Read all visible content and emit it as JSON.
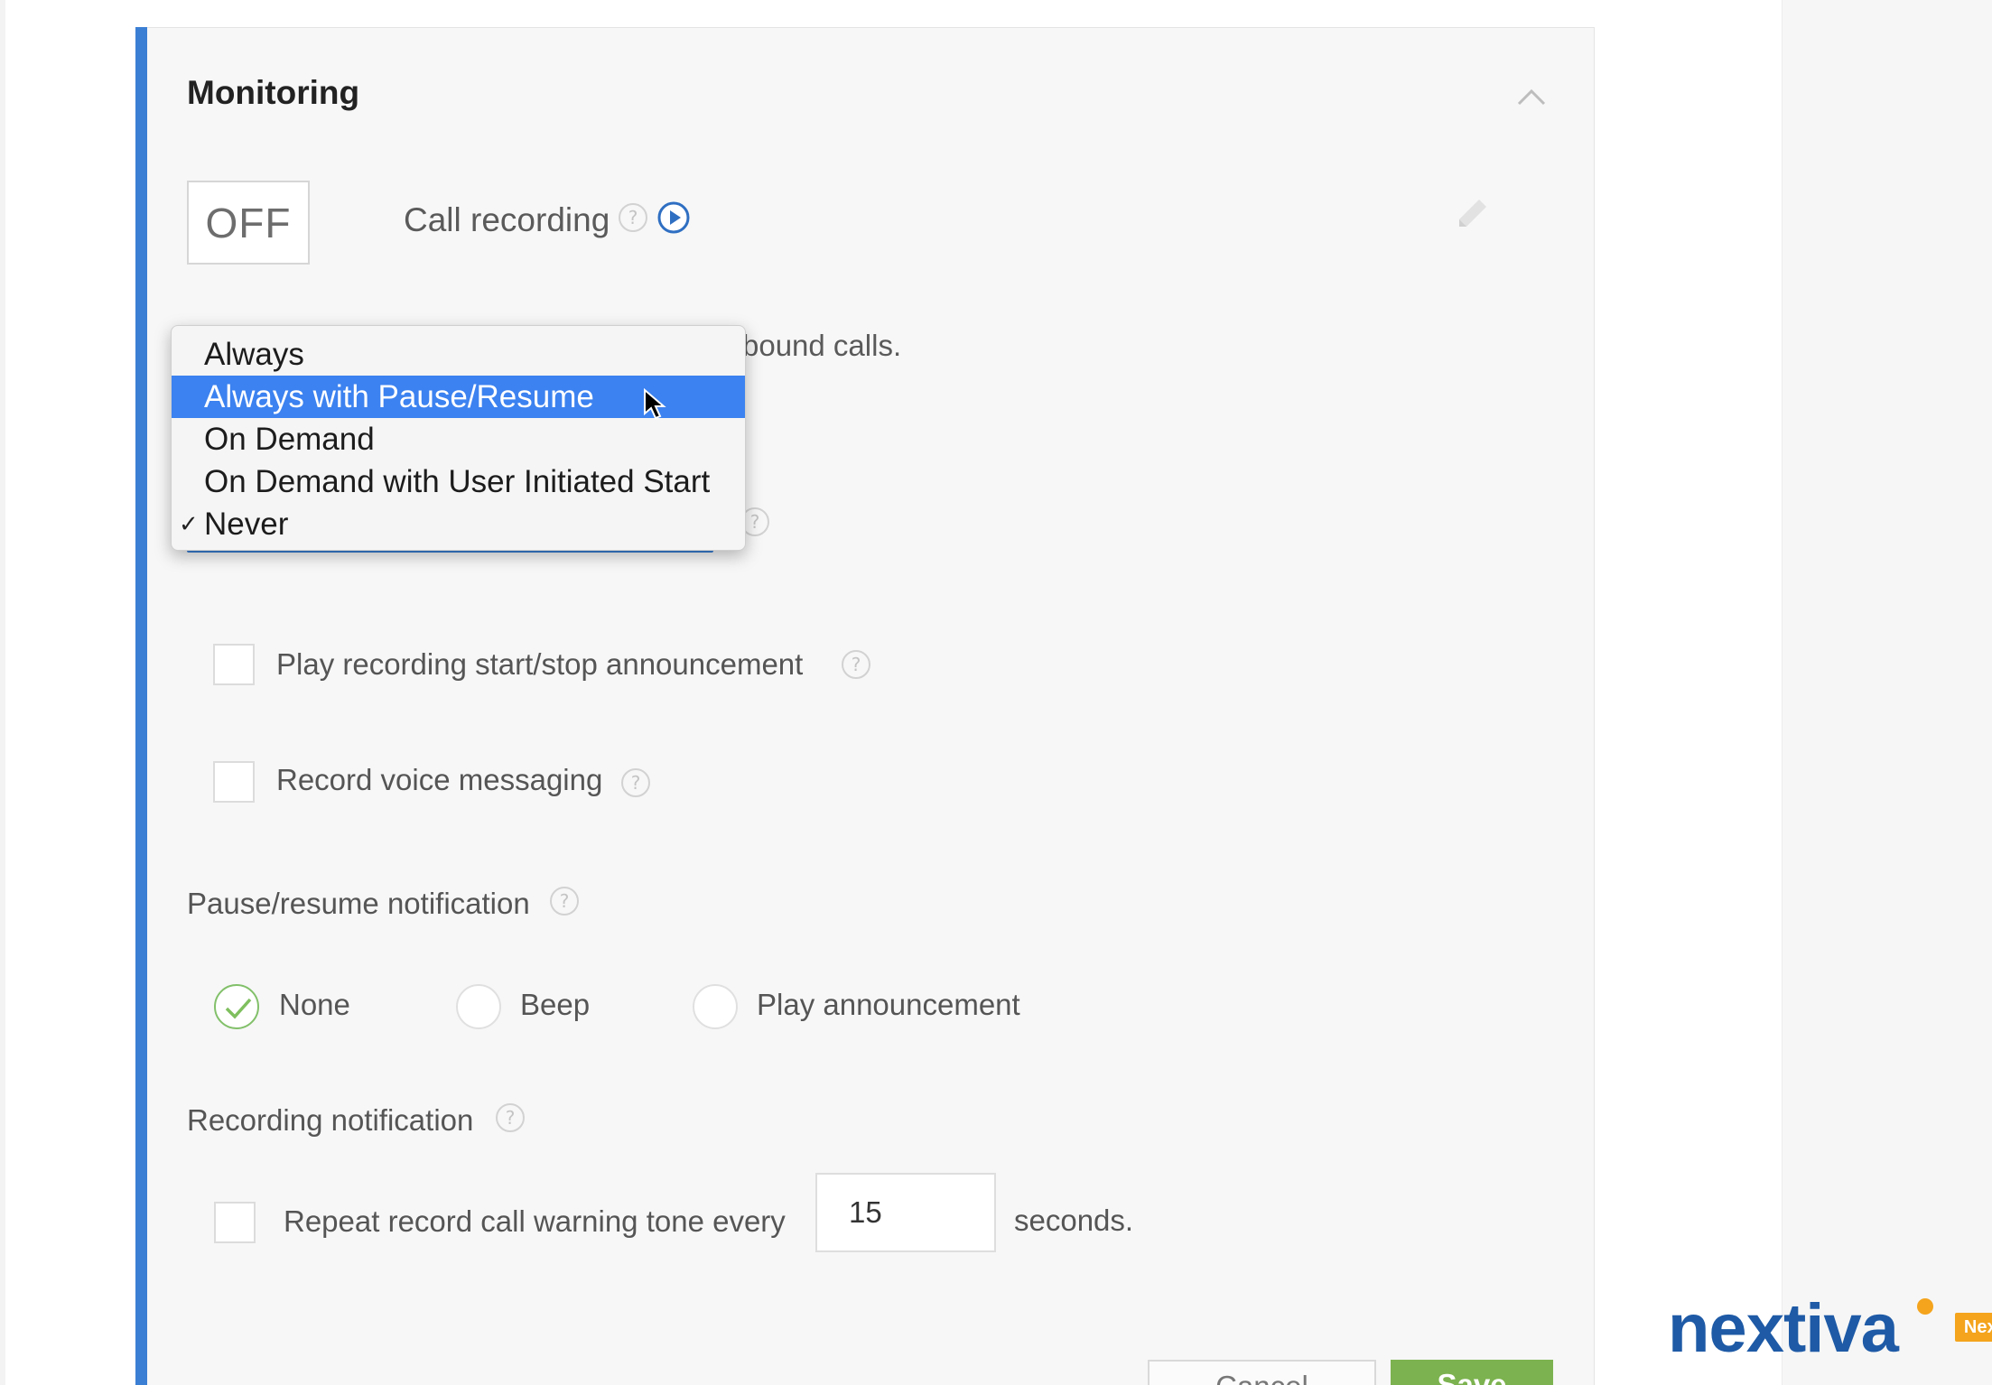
{
  "section": {
    "title": "Monitoring"
  },
  "call_recording": {
    "toggle_state": "OFF",
    "label": "Call recording",
    "help_glyph": "?",
    "bg_text": "bound calls.",
    "options": [
      {
        "label": "Always",
        "checked": false,
        "highlighted": false
      },
      {
        "label": "Always with Pause/Resume",
        "checked": false,
        "highlighted": true
      },
      {
        "label": "On Demand",
        "checked": false,
        "highlighted": false
      },
      {
        "label": "On Demand with User Initiated Start",
        "checked": false,
        "highlighted": false
      },
      {
        "label": "Never",
        "checked": true,
        "highlighted": false
      }
    ],
    "check_glyph": "✓"
  },
  "checkboxes": {
    "play_announcement": {
      "label": "Play recording start/stop announcement",
      "checked": false
    },
    "record_voice": {
      "label": "Record voice messaging",
      "checked": false
    }
  },
  "pause_resume": {
    "title": "Pause/resume notification",
    "options": [
      {
        "label": "None",
        "selected": true
      },
      {
        "label": "Beep",
        "selected": false
      },
      {
        "label": "Play announcement",
        "selected": false
      }
    ]
  },
  "recording_notification": {
    "title": "Recording notification",
    "repeat_label": "Repeat record call warning tone every",
    "seconds_value": "15",
    "seconds_suffix": "seconds.",
    "checked": false
  },
  "buttons": {
    "cancel": "Cancel",
    "save": "Save"
  },
  "brand": {
    "name": "nextiva",
    "badge": "NextOS"
  },
  "colors": {
    "accent": "#3b7fd4",
    "highlight": "#3c82f0",
    "success": "#7cb24f",
    "brand_blue": "#1e5aa6",
    "brand_orange": "#f4a41d"
  },
  "icons": {
    "collapse": "chevron-up-icon",
    "help": "question-circle-icon",
    "play": "play-circle-icon",
    "edit": "pencil-icon",
    "check": "checkmark-icon",
    "cursor": "mouse-pointer-icon"
  }
}
